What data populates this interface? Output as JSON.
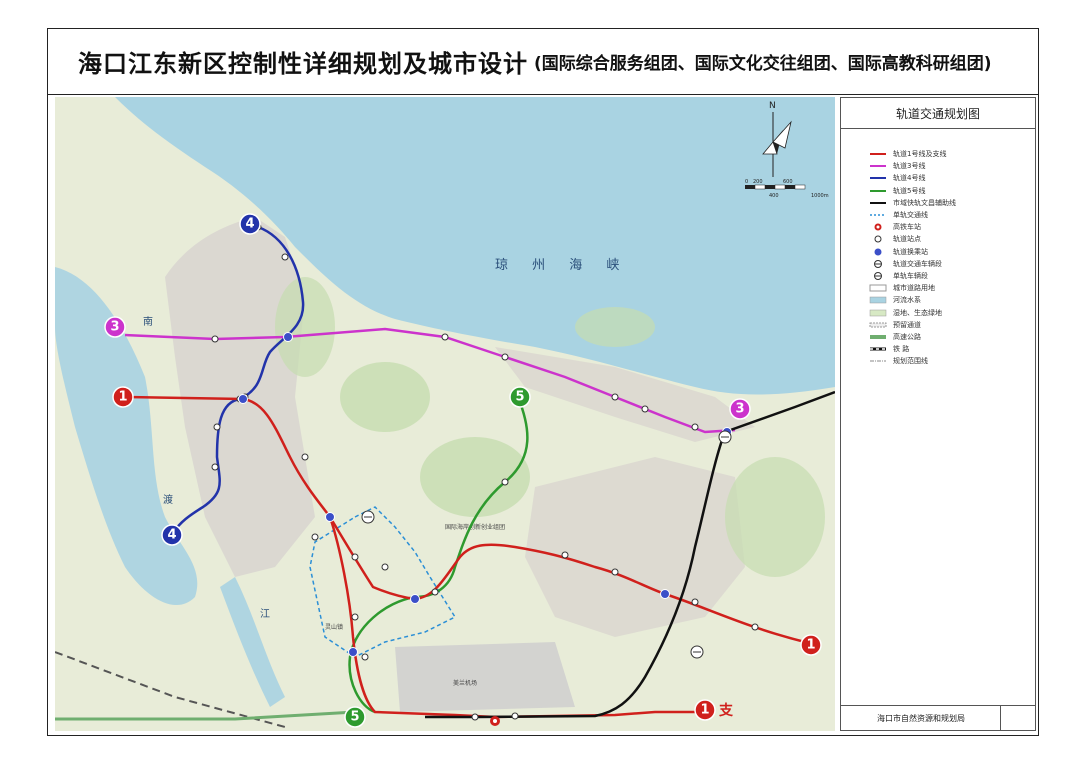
{
  "title": {
    "main": "海口江东新区控制性详细规划及城市设计",
    "sub": "(国际综合服务组团、国际文化交往组团、国际高教科研组团)"
  },
  "map": {
    "strait_label": "琼 州 海 峡",
    "north_label": "N",
    "scale_labels": [
      "0",
      "200",
      "400",
      "600",
      "1000m"
    ],
    "area_labels": [
      "国际海岸创新创业组团",
      "美兰机场",
      "南",
      "渡",
      "江",
      "灵山镇"
    ],
    "line_badges": [
      {
        "id": "line1",
        "label": "1",
        "color": "#d0201c"
      },
      {
        "id": "line1b",
        "label": "1",
        "color": "#d0201c"
      },
      {
        "id": "line1_branch",
        "label": "1",
        "suffix": "支",
        "color": "#d0201c"
      },
      {
        "id": "line3",
        "label": "3",
        "color": "#cc33cc"
      },
      {
        "id": "line3b",
        "label": "3",
        "color": "#cc33cc"
      },
      {
        "id": "line4",
        "label": "4",
        "color": "#2233aa"
      },
      {
        "id": "line4b",
        "label": "4",
        "color": "#2233aa"
      },
      {
        "id": "line5",
        "label": "5",
        "color": "#2e9a2e"
      },
      {
        "id": "line5b",
        "label": "5",
        "color": "#2e9a2e"
      }
    ]
  },
  "legend": {
    "title": "轨道交通规划图",
    "items": [
      {
        "label": "轨道1号线及支线",
        "type": "line",
        "color": "#d0201c"
      },
      {
        "label": "轨道3号线",
        "type": "line",
        "color": "#cc33cc"
      },
      {
        "label": "轨道4号线",
        "type": "line",
        "color": "#2233aa"
      },
      {
        "label": "轨道5号线",
        "type": "line",
        "color": "#2e9a2e"
      },
      {
        "label": "市域快轨文昌辅助线",
        "type": "line",
        "color": "#111111"
      },
      {
        "label": "单轨交通线",
        "type": "dashed",
        "color": "#2b8fd6"
      },
      {
        "label": "高铁车站",
        "type": "rail-station",
        "color": "#d0201c"
      },
      {
        "label": "轨道站点",
        "type": "station",
        "color": "#ffffff"
      },
      {
        "label": "轨道换乘站",
        "type": "transfer",
        "color": "#3b4fc8"
      },
      {
        "label": "轨道交通车辆段",
        "type": "depot",
        "color": "#ffffff"
      },
      {
        "label": "单轨车辆段",
        "type": "depot",
        "color": "#ffffff"
      },
      {
        "label": "城市道路用地",
        "type": "road",
        "color": "#ffffff"
      },
      {
        "label": "河流水系",
        "type": "fill",
        "color": "#a9d3e2"
      },
      {
        "label": "湿地、生态绿地",
        "type": "fill",
        "color": "#d7e9c4"
      },
      {
        "label": "预留通道",
        "type": "reserved",
        "color": "#999999"
      },
      {
        "label": "高速公路",
        "type": "highway",
        "color": "#6fae6f"
      },
      {
        "label": "铁 路",
        "type": "railway",
        "color": "#111111"
      },
      {
        "label": "规划范围线",
        "type": "boundary",
        "color": "#888888"
      }
    ],
    "footer": "海口市自然资源和规划局"
  }
}
